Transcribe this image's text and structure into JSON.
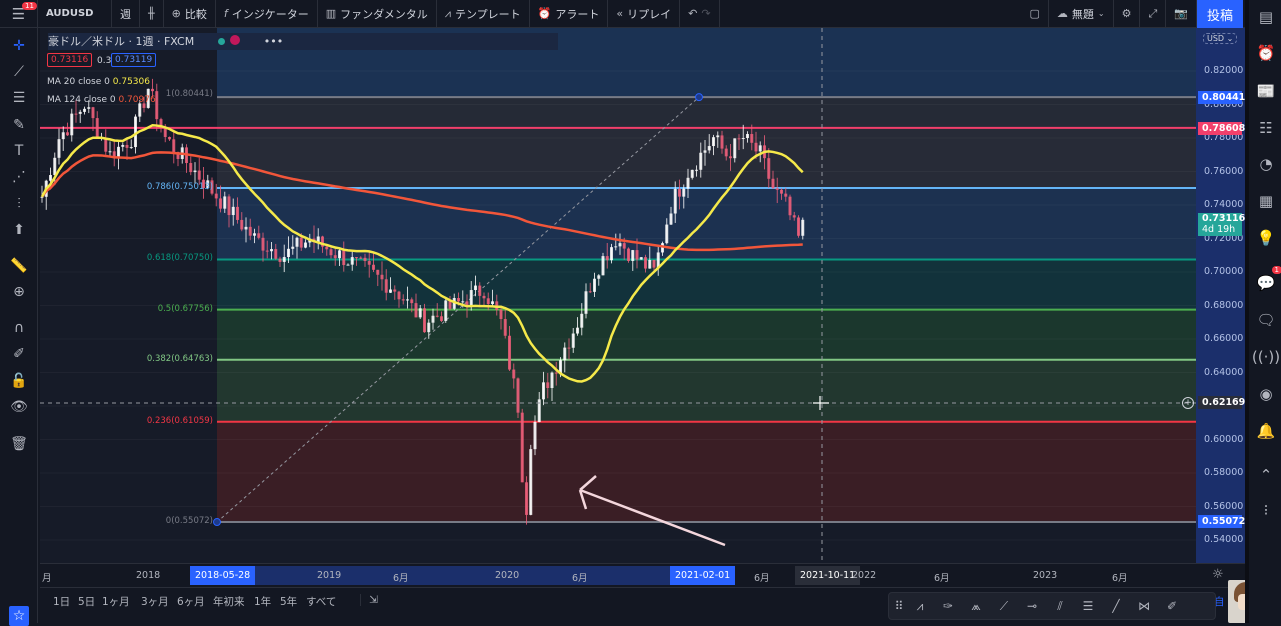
{
  "topbar": {
    "menu_badge": "11",
    "symbol": "AUDUSD",
    "interval": "週",
    "compare": "比較",
    "indicators": "インジケーター",
    "fundamentals": "ファンダメンタル",
    "templates": "テンプレート",
    "alerts": "アラート",
    "replay": "リプレイ",
    "layout_name": "無題",
    "post": "投稿"
  },
  "legend": {
    "title": "豪ドル／米ドル · 1週 · FXCM",
    "bid": "0.73116",
    "spread": "0.3",
    "ask": "0.73119",
    "ma20_label": "MA 20 close 0",
    "ma20_value": "0.75306",
    "ma124_label": "MA 124 close 0",
    "ma124_value": "0.70976"
  },
  "fib_levels": [
    {
      "label": "1(0.80441)",
      "price": 0.80441,
      "color": "#787b86"
    },
    {
      "label": "0.786(0.75013)",
      "price": 0.75013,
      "color": "#64b5f6"
    },
    {
      "label": "0.618(0.70750)",
      "price": 0.7075,
      "color": "#089981"
    },
    {
      "label": "0.5(0.67756)",
      "price": 0.67756,
      "color": "#4caf50"
    },
    {
      "label": "0.382(0.64763)",
      "price": 0.64763,
      "color": "#81c784"
    },
    {
      "label": "0.236(0.61059)",
      "price": 0.61059,
      "color": "#f23645"
    },
    {
      "label": "0(0.55072)",
      "price": 0.55072,
      "color": "#787b86"
    }
  ],
  "hline": {
    "price": 0.78608,
    "label": "0.78608",
    "color": "#f23f6b"
  },
  "price_axis": {
    "currency": "USD",
    "ticks": [
      "0.82000",
      "0.80000",
      "0.78000",
      "0.76000",
      "0.74000",
      "0.72000",
      "0.70000",
      "0.68000",
      "0.66000",
      "0.64000",
      "0.60000",
      "0.58000",
      "0.56000",
      "0.54000"
    ],
    "tick_values": [
      0.82,
      0.8,
      0.78,
      0.76,
      0.74,
      0.72,
      0.7,
      0.68,
      0.66,
      0.64,
      0.6,
      0.58,
      0.56,
      0.54
    ],
    "top_tag": "0.80441",
    "low_tag": "0.55072",
    "last_price": "0.73116",
    "countdown": "4d 19h",
    "crosshair_price": "0.62169"
  },
  "time_axis": {
    "labels": [
      "月",
      "2018",
      "2019",
      "6月",
      "2020",
      "6月",
      "6月",
      "2022",
      "6月",
      "2023",
      "6月"
    ],
    "range_start": "2018-05-28",
    "range_end": "2021-02-01",
    "crosshair_date": "2021-10-11"
  },
  "bottombar": {
    "timeframes": [
      "1日",
      "5日",
      "1ヶ月",
      "3ヶ月",
      "6ヶ月",
      "年初来",
      "1年",
      "5年",
      "すべて"
    ],
    "partial_text": "ル",
    "auto": "自"
  },
  "right_badge": "1",
  "price_path": [
    [
      0,
      0.745
    ],
    [
      4,
      0.78
    ],
    [
      10,
      0.8
    ],
    [
      16,
      0.77
    ],
    [
      21,
      0.78
    ],
    [
      25,
      0.81
    ],
    [
      29,
      0.78
    ],
    [
      36,
      0.76
    ],
    [
      43,
      0.74
    ],
    [
      50,
      0.72
    ],
    [
      57,
      0.71
    ],
    [
      63,
      0.72
    ],
    [
      70,
      0.71
    ],
    [
      77,
      0.7
    ],
    [
      83,
      0.69
    ],
    [
      90,
      0.67
    ],
    [
      97,
      0.68
    ],
    [
      104,
      0.69
    ],
    [
      108,
      0.67
    ],
    [
      112,
      0.62
    ],
    [
      113,
      0.58
    ],
    [
      114,
      0.56
    ],
    [
      115,
      0.6
    ],
    [
      118,
      0.63
    ],
    [
      122,
      0.65
    ],
    [
      126,
      0.67
    ],
    [
      130,
      0.7
    ],
    [
      135,
      0.72
    ],
    [
      139,
      0.71
    ],
    [
      144,
      0.7
    ],
    [
      148,
      0.74
    ],
    [
      152,
      0.76
    ],
    [
      155,
      0.77
    ],
    [
      158,
      0.78
    ],
    [
      161,
      0.77
    ],
    [
      165,
      0.78
    ],
    [
      169,
      0.77
    ],
    [
      172,
      0.75
    ],
    [
      175,
      0.74
    ],
    [
      178,
      0.72
    ],
    [
      179,
      0.731
    ]
  ]
}
